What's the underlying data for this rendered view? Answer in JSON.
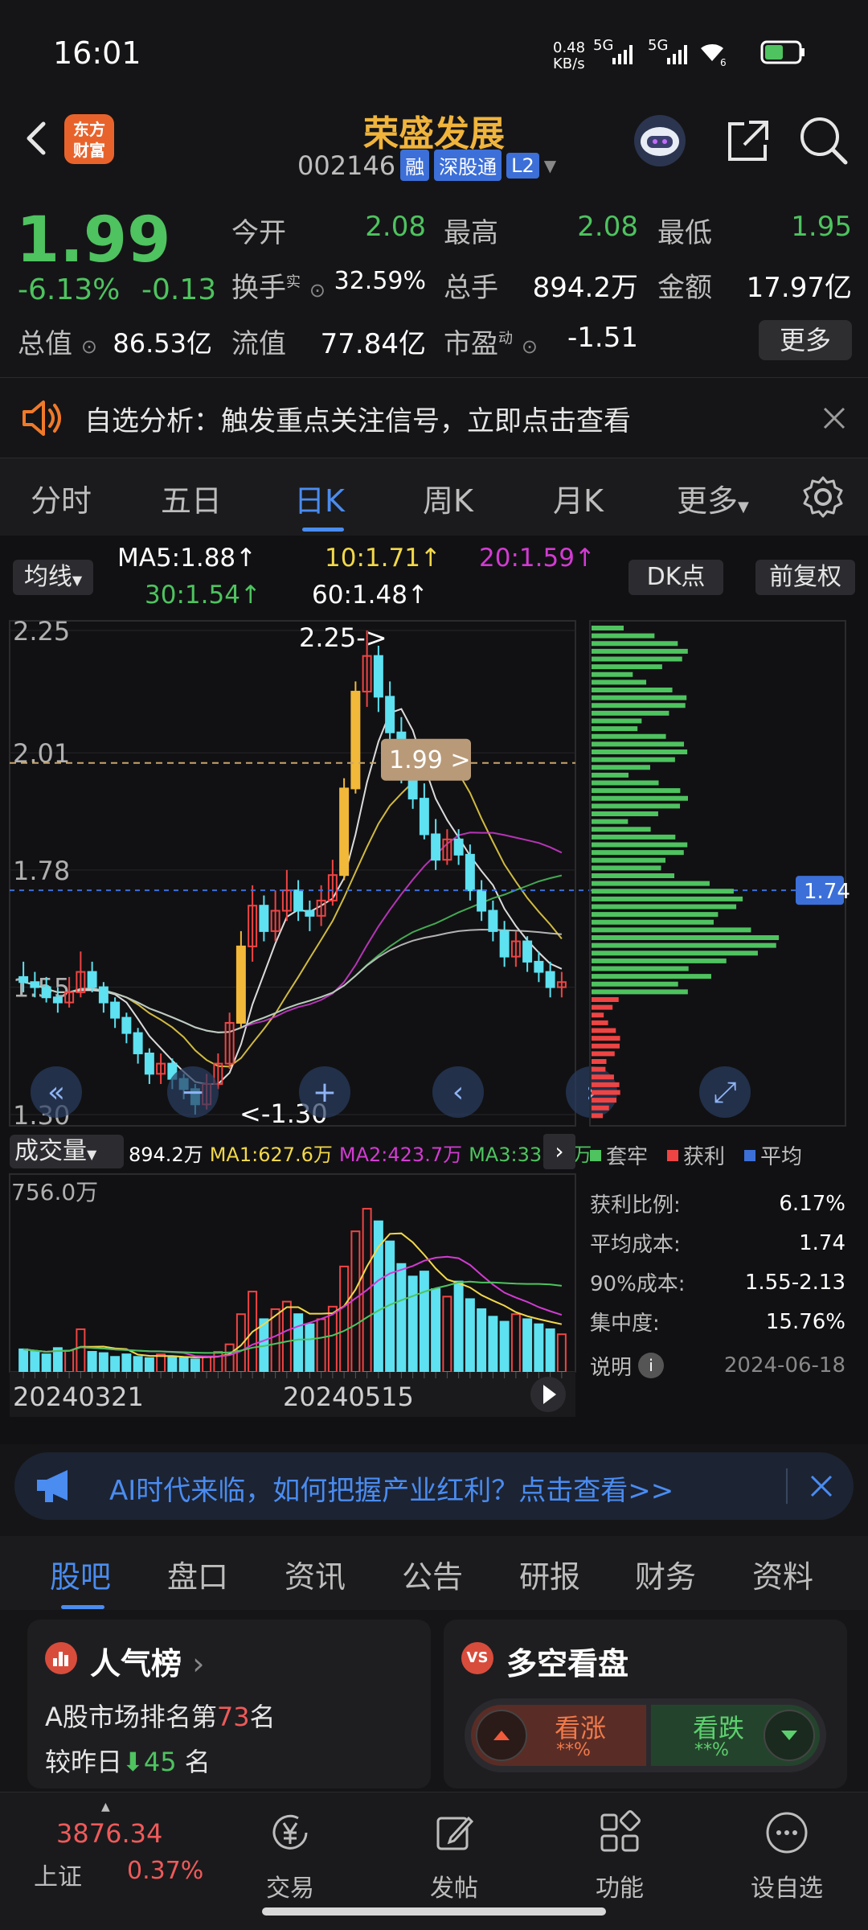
{
  "status_bar": {
    "time": "16:01",
    "net_speed_top": "0.48",
    "net_speed_bottom": "KB/s",
    "sim1": "5G",
    "sim2": "5G",
    "wifi_num": "6"
  },
  "header": {
    "logo_line1": "东方",
    "logo_line2": "财富",
    "title": "荣盛发展",
    "code": "002146",
    "tag_rong": "融",
    "tag_sgt": "深股通",
    "tag_l2": "L2"
  },
  "quote": {
    "price": "1.99",
    "change_pct": "-6.13%",
    "change": "-0.13",
    "labels": {
      "open": "今开",
      "high": "最高",
      "low": "最低",
      "turnover": "换手",
      "turnover_sup": "实",
      "volume": "总手",
      "amount": "金额",
      "mktcap": "总值",
      "float_cap": "流值",
      "pe": "市盈",
      "pe_sup": "动"
    },
    "values": {
      "open": "2.08",
      "high": "2.08",
      "low": "1.95",
      "turnover": "32.59%",
      "volume": "894.2万",
      "amount": "17.97亿",
      "mktcap": "86.53亿",
      "float_cap": "77.84亿",
      "pe": "-1.51"
    },
    "more_label": "更多"
  },
  "notice": {
    "text": "自选分析：触发重点关注信号，立即点击查看"
  },
  "period_tabs": {
    "items": [
      "分时",
      "五日",
      "日K",
      "周K",
      "月K",
      "更多"
    ],
    "active": "日K"
  },
  "chart_header": {
    "ma_select": "均线",
    "ma5": "MA5:1.88",
    "ma10": "10:1.71",
    "ma20": "20:1.59",
    "ma30": "30:1.54",
    "ma60": "60:1.48",
    "dk_label": "DK点",
    "adjust_label": "前复权"
  },
  "chart_data": {
    "type": "candlestick",
    "y_ticks": [
      "2.25",
      "2.01",
      "1.78",
      "1.55",
      "1.30"
    ],
    "ylim": [
      1.3,
      2.25
    ],
    "high_marker": "2.25->",
    "low_marker": "<-1.30",
    "current_price_tag": "1.99 >",
    "avg_cost_tag": "1.74",
    "x_labels": [
      "20240321",
      "20240515"
    ],
    "candles": [
      [
        1.57,
        1.56,
        1.6,
        1.54
      ],
      [
        1.56,
        1.55,
        1.58,
        1.53
      ],
      [
        1.55,
        1.53,
        1.57,
        1.52
      ],
      [
        1.53,
        1.52,
        1.55,
        1.5
      ],
      [
        1.52,
        1.54,
        1.57,
        1.51
      ],
      [
        1.54,
        1.58,
        1.62,
        1.53
      ],
      [
        1.58,
        1.55,
        1.6,
        1.54
      ],
      [
        1.55,
        1.52,
        1.56,
        1.5
      ],
      [
        1.52,
        1.49,
        1.53,
        1.47
      ],
      [
        1.49,
        1.46,
        1.5,
        1.44
      ],
      [
        1.46,
        1.42,
        1.47,
        1.4
      ],
      [
        1.42,
        1.38,
        1.43,
        1.36
      ],
      [
        1.38,
        1.4,
        1.42,
        1.36
      ],
      [
        1.4,
        1.37,
        1.41,
        1.35
      ],
      [
        1.37,
        1.35,
        1.38,
        1.33
      ],
      [
        1.35,
        1.32,
        1.36,
        1.3
      ],
      [
        1.32,
        1.36,
        1.38,
        1.31
      ],
      [
        1.36,
        1.4,
        1.42,
        1.35
      ],
      [
        1.4,
        1.48,
        1.5,
        1.39
      ],
      [
        1.48,
        1.63,
        1.66,
        1.47
      ],
      [
        1.63,
        1.71,
        1.75,
        1.6
      ],
      [
        1.71,
        1.66,
        1.73,
        1.64
      ],
      [
        1.66,
        1.7,
        1.74,
        1.64
      ],
      [
        1.7,
        1.74,
        1.78,
        1.68
      ],
      [
        1.74,
        1.7,
        1.76,
        1.68
      ],
      [
        1.7,
        1.69,
        1.72,
        1.66
      ],
      [
        1.69,
        1.72,
        1.75,
        1.67
      ],
      [
        1.72,
        1.77,
        1.8,
        1.71
      ],
      [
        1.77,
        1.94,
        1.96,
        1.76
      ],
      [
        1.94,
        2.13,
        2.15,
        1.93
      ],
      [
        2.13,
        2.2,
        2.25,
        2.1
      ],
      [
        2.2,
        2.12,
        2.22,
        2.09
      ],
      [
        2.12,
        2.05,
        2.15,
        2.03
      ],
      [
        2.05,
        1.98,
        2.08,
        1.95
      ],
      [
        1.98,
        1.92,
        2.0,
        1.9
      ],
      [
        1.92,
        1.85,
        1.95,
        1.84
      ],
      [
        1.85,
        1.8,
        1.88,
        1.78
      ],
      [
        1.8,
        1.84,
        1.86,
        1.79
      ],
      [
        1.84,
        1.81,
        1.86,
        1.79
      ],
      [
        1.81,
        1.74,
        1.83,
        1.72
      ],
      [
        1.74,
        1.7,
        1.76,
        1.68
      ],
      [
        1.7,
        1.66,
        1.72,
        1.64
      ],
      [
        1.66,
        1.61,
        1.68,
        1.59
      ],
      [
        1.61,
        1.64,
        1.66,
        1.59
      ],
      [
        1.64,
        1.6,
        1.65,
        1.58
      ],
      [
        1.6,
        1.58,
        1.62,
        1.56
      ],
      [
        1.58,
        1.55,
        1.6,
        1.53
      ],
      [
        1.55,
        1.56,
        1.58,
        1.53
      ]
    ],
    "volume_title": "成交量",
    "volume_values": {
      "vol": "894.2万",
      "ma1": "MA1:627.6万",
      "ma2": "MA2:423.7万",
      "ma3": "MA3:333.2万"
    },
    "volume_max_label": "756.0万",
    "volume_max": 756,
    "volumes": [
      90,
      80,
      70,
      95,
      85,
      170,
      80,
      75,
      60,
      70,
      60,
      55,
      70,
      60,
      55,
      50,
      60,
      80,
      110,
      230,
      320,
      210,
      250,
      280,
      230,
      190,
      210,
      260,
      420,
      560,
      650,
      600,
      520,
      430,
      380,
      400,
      330,
      300,
      360,
      290,
      250,
      220,
      200,
      230,
      210,
      190,
      170,
      150
    ]
  },
  "distribution": {
    "legend": [
      "套牢",
      "获利",
      "平均"
    ],
    "rows": [
      {
        "label": "获利比例:",
        "value": "6.17%"
      },
      {
        "label": "平均成本:",
        "value": "1.74"
      },
      {
        "label": "90%成本:",
        "value": "1.55-2.13"
      },
      {
        "label": "集中度:",
        "value": "15.76%"
      }
    ],
    "note_label": "说明",
    "date": "2024-06-18"
  },
  "ad": {
    "text": "AI时代来临，如何把握产业红利？点击查看>>"
  },
  "bottom_tabs": {
    "items": [
      "股吧",
      "盘口",
      "资讯",
      "公告",
      "研报",
      "财务",
      "资料"
    ],
    "active": "股吧"
  },
  "cards": {
    "popularity": {
      "title": "人气榜",
      "line1_prefix": "A股市场排名第",
      "rank": "73",
      "line1_suffix": "名",
      "line2_prefix": "较昨日",
      "delta": "45",
      "line2_suffix": "名"
    },
    "sentiment": {
      "title": "多空看盘",
      "badge": "VS",
      "bull_label": "看涨",
      "bull_value": "**%",
      "bear_label": "看跌",
      "bear_value": "**%"
    }
  },
  "bottom_nav": {
    "index_value": "3876.34",
    "index_name": "上证",
    "index_change": "0.37%",
    "items": [
      "交易",
      "发帖",
      "功能",
      "设自选"
    ]
  }
}
